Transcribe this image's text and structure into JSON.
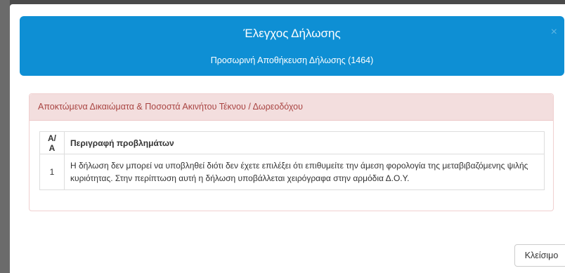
{
  "modal": {
    "title": "Έλεγχος Δήλωσης",
    "subtitle": "Προσωρινή Αποθήκευση Δήλωσης (1464)",
    "close_icon": "×",
    "close_button_label": "Κλείσιμο"
  },
  "panel": {
    "heading": "Αποκτώμενα Δικαιώματα & Ποσοστά Ακινήτου Τέκνου / Δωρεοδόχου",
    "table": {
      "headers": [
        "Α/Α",
        "Περιγραφή προβλημάτων"
      ],
      "rows": [
        {
          "index": "1",
          "description": "Η δήλωση δεν μπορεί να υποβληθεί διότι δεν έχετε επιλέξει ότι επιθυμείτε την άμεση φορολογία της μεταβιβαζόμενης ψιλής κυριότητας. Στην περίπτωση αυτή η δήλωση υποβάλλεται χειρόγραφα στην αρμόδια Δ.Ο.Υ."
        }
      ]
    }
  },
  "colors": {
    "header_bg": "#0e8fd4",
    "panel_heading_bg": "#f3dede",
    "panel_heading_text": "#a94442"
  }
}
